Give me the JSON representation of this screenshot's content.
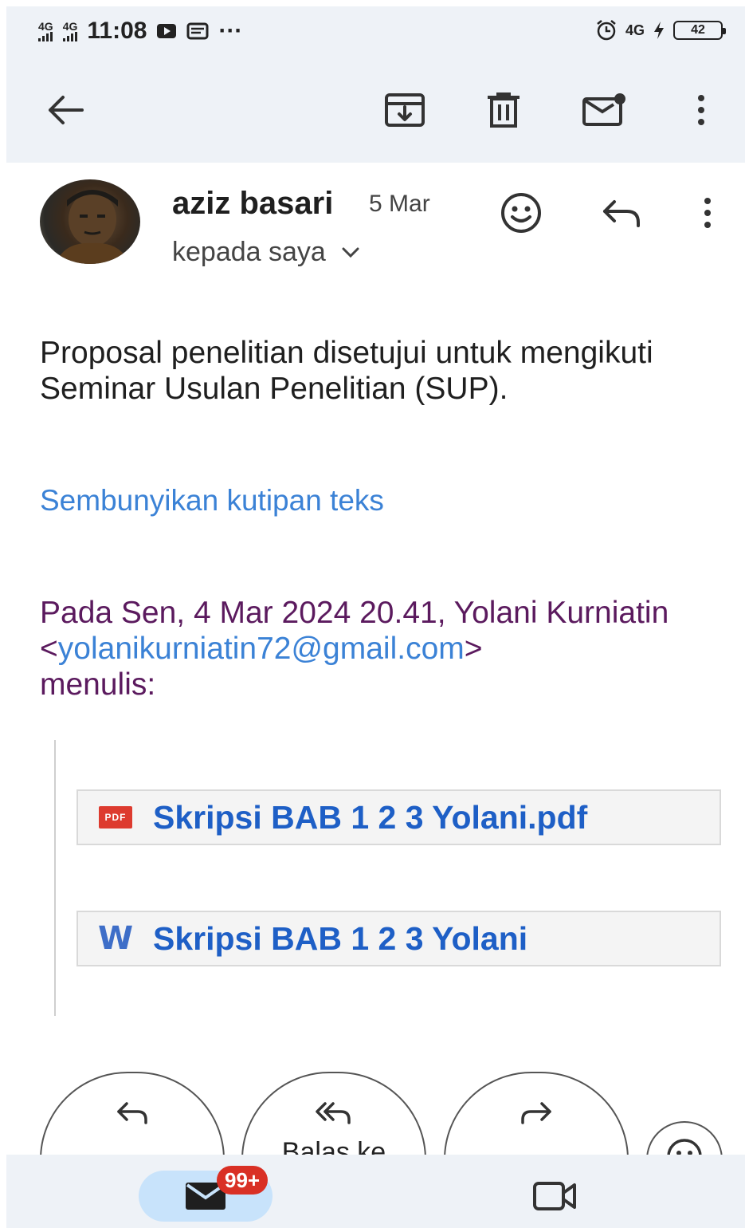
{
  "status_bar": {
    "time": "11:08",
    "signal1": "4G",
    "signal2": "4G",
    "net_right": "4G",
    "battery": "42"
  },
  "toolbar": {
    "icons": [
      "back-arrow-icon",
      "archive-icon",
      "delete-icon",
      "mark-unread-icon",
      "more-vert-icon"
    ]
  },
  "email": {
    "sender": "aziz basari",
    "date": "5 Mar",
    "to": "kepada saya",
    "body": "Proposal penelitian disetujui untuk mengikuti Seminar Usulan Penelitian (SUP).",
    "hide_quote": "Sembunyikan kutipan teks",
    "quote_prefix": "Pada Sen, 4 Mar 2024 20.41, Yolani Kurniatin <",
    "quote_email": "yolanikurniatin72@gmail.com",
    "quote_suffix": ">",
    "quote_wrote": "menulis:"
  },
  "attachments": [
    {
      "type": "pdf",
      "badge": "PDF",
      "name": "Skripsi BAB 1 2 3 Yolani.pdf"
    },
    {
      "type": "word",
      "badge": "W",
      "name": "Skripsi BAB 1 2 3 Yolani"
    }
  ],
  "actions": {
    "reply_all_label": "Balas ke"
  },
  "bottom_nav": {
    "mail_badge": "99+"
  },
  "colors": {
    "accent_blue": "#3b82d6",
    "attachment_blue": "#1e5fc6",
    "quote_purple": "#5b1a5e",
    "badge_red": "#d93025",
    "bar_bg": "#eef2f7"
  }
}
